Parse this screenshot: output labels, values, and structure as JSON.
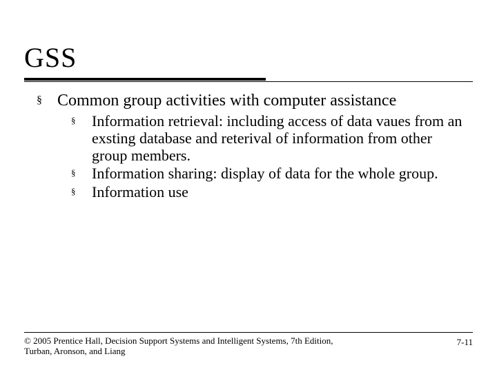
{
  "title": "GSS",
  "main_bullet": "Common group activities with computer assistance",
  "sub_bullets": [
    "Information retrieval: including access of data vaues from an exsting database and reterival of information from other group members.",
    "Information sharing: display of data for the whole group.",
    "Information use"
  ],
  "footer": {
    "copyright": "© 2005 Prentice Hall, Decision Support Systems and Intelligent Systems, 7th Edition, Turban, Aronson, and Liang",
    "page": "7-11"
  }
}
